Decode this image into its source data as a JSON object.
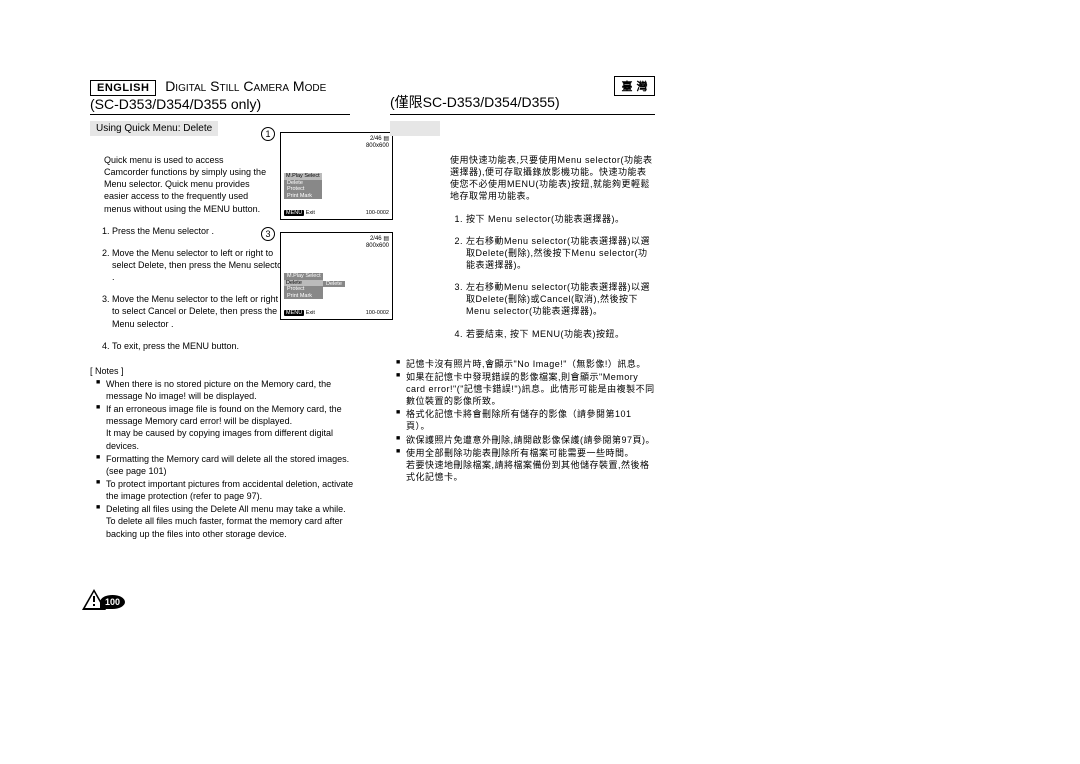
{
  "left": {
    "lang": "ENGLISH",
    "title": "Digital Still Camera Mode",
    "subtitle": "(SC-D353/D354/D355 only)",
    "section": "Using Quick Menu: Delete",
    "intro": "Quick menu is used to access Camcorder functions by simply using the Menu selector. Quick menu provides easier access to the frequently used menus without using the MENU button.",
    "s1": "Press the Menu selector .",
    "s2": "Move the Menu selector  to left or right to select Delete, then press the Menu selector  .",
    "s3": "Move the Menu selector  to the left or right to select Cancel or Delete, then press the Menu selector  .",
    "s4": "To exit, press the MENU button.",
    "notesLabel": "[ Notes ]",
    "n1": "When there is no stored picture on the Memory card, the message No image! will be displayed.",
    "n2": "If an erroneous image file is found on the Memory card, the message Memory card error! will be displayed.",
    "n2b": "It may be caused by copying images from different digital devices.",
    "n3": "Formatting the Memory card will delete all the stored images. (see page 101)",
    "n4": "To protect important pictures from accidental deletion, activate the image protection (refer to page 97).",
    "n5": "Deleting all files using the Delete All menu may take a while.",
    "n5b": "To delete all files much faster, format the memory card after backing up the files into other storage device.",
    "pageNum": "100"
  },
  "right": {
    "langBox": "臺  灣",
    "titleBox": "(僅限SC-D353/D354/D355)",
    "sectionBlank": "",
    "intro1": "使用快速功能表,只要使用Menu selector(功能表選擇器),便可存取攝錄放影機功能。快速功能表使您不必使用MENU(功能表)按鈕,就能夠更輕鬆地存取常用功能表。",
    "s1": "按下 Menu selector(功能表選擇器)。",
    "s2": "左右移動Menu selector(功能表選擇器)以選取Delete(刪除),然後按下Menu selector(功能表選擇器)。",
    "s3": "左右移動Menu selector(功能表選擇器)以選取Delete(刪除)或Cancel(取消),然後按下Menu selector(功能表選擇器)。",
    "s4": "若要結束, 按下 MENU(功能表)按鈕。",
    "nn1": "記憶卡沒有照片時,會顯示\"No Image!\"（無影像!）訊息。",
    "nn2": "如果在記憶卡中發現錯誤的影像檔案,則會顯示\"Memory card error!\"(\"記憶卡錯誤!\")訊息。此情形可能是由複製不同數位裝置的影像所致。",
    "nn3": "格式化記憶卡將會刪除所有儲存的影像（請參閱第101頁）。",
    "nn4": "欲保護照片免遭意外刪除,請開啟影像保護(請參閱第97頁)。",
    "nn5": "使用全部刪除功能表刪除所有檔案可能需要一些時間。",
    "nn5b": "若要快速地刪除檔案,請將檔案備份到其他儲存裝置,然後格式化記憶卡。"
  },
  "figs": {
    "counter": "2/46",
    "res": "800x600",
    "id": "100-0002",
    "m1": "M.Play Select",
    "m2": "Delete",
    "m3": "Protect",
    "m4": "Print Mark",
    "exit": "Exit",
    "sub": "Delete"
  }
}
